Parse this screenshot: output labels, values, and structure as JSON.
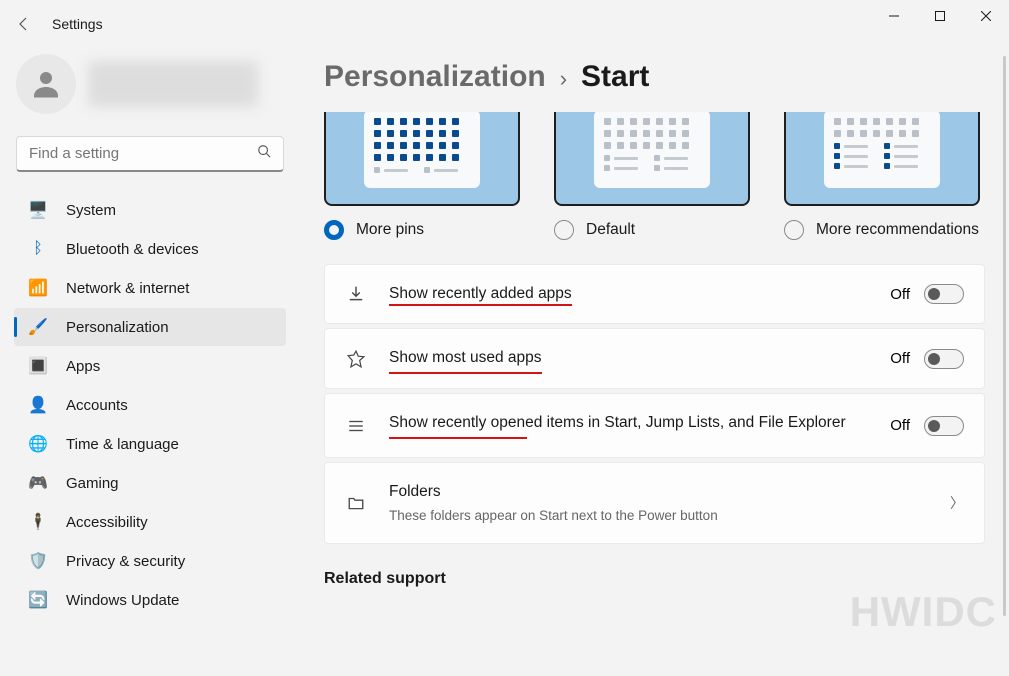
{
  "app_title": "Settings",
  "search": {
    "placeholder": "Find a setting"
  },
  "nav": {
    "system": "System",
    "bluetooth": "Bluetooth & devices",
    "network": "Network & internet",
    "personalization": "Personalization",
    "apps": "Apps",
    "accounts": "Accounts",
    "time": "Time & language",
    "gaming": "Gaming",
    "accessibility": "Accessibility",
    "privacy": "Privacy & security",
    "update": "Windows Update"
  },
  "breadcrumb": {
    "parent": "Personalization",
    "sep": "›",
    "current": "Start"
  },
  "layout_options": {
    "more_pins": "More pins",
    "default": "Default",
    "more_recs": "More recommendations",
    "selected": "more_pins"
  },
  "settings": {
    "recently_added": {
      "label": "Show recently added apps",
      "state": "Off"
    },
    "most_used": {
      "label": "Show most used apps",
      "state": "Off"
    },
    "recently_opened": {
      "label": "Show recently opened items in Start, Jump Lists, and File Explorer",
      "state": "Off"
    },
    "folders": {
      "label": "Folders",
      "sub": "These folders appear on Start next to the Power button"
    }
  },
  "related_support": "Related support",
  "watermark": "HWIDC"
}
